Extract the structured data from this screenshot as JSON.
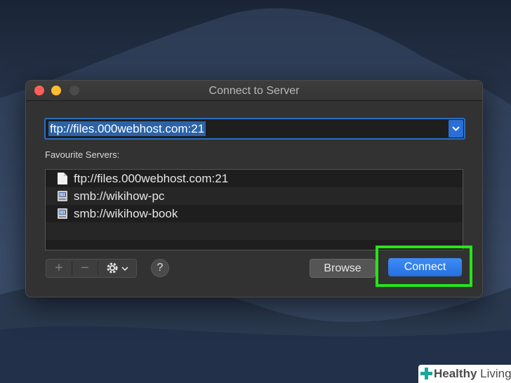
{
  "window": {
    "title": "Connect to Server"
  },
  "address": {
    "value": "ftp://files.000webhost.com:21"
  },
  "favourites": {
    "label": "Favourite Servers:",
    "items": [
      {
        "label": "ftp://files.000webhost.com:21",
        "icon": "document-icon"
      },
      {
        "label": "smb://wikihow-pc",
        "icon": "server-icon"
      },
      {
        "label": "smb://wikihow-book",
        "icon": "server-icon"
      }
    ]
  },
  "buttons": {
    "add": "+",
    "remove": "−",
    "help": "?",
    "browse": "Browse",
    "connect": "Connect"
  },
  "watermark": {
    "brand_bold": "Healthy",
    "brand_rest": " Living"
  },
  "colors": {
    "accent": "#2a6fd6",
    "highlight": "#27e31a"
  }
}
